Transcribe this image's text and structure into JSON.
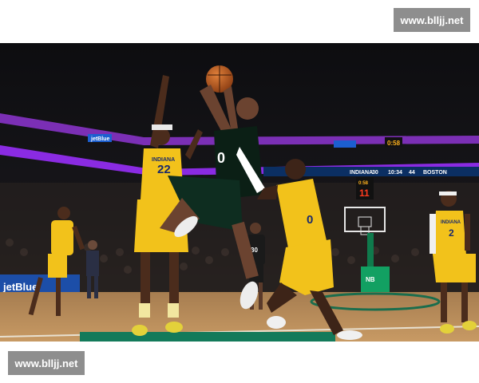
{
  "watermark": {
    "text": "www.blljj.net"
  },
  "scene": {
    "description_hidden": "",
    "ribbon_upper": {
      "brand": "jetBlue",
      "score_small": "0:58"
    },
    "ribbon_lower": {
      "team_home": "INDIANA",
      "score_home": "30",
      "clock": "10:34",
      "score_away": "44",
      "team_away": "BOSTON"
    },
    "shot_clock": "11",
    "shot_clock_top": "0:58",
    "courtside_ad": "jetBlue",
    "court_logo": "NB",
    "jerseys": {
      "left_defender": "22",
      "left_defender_team": "INDIANA",
      "shooter": "0",
      "right_defender": "0",
      "far_right": "2",
      "far_right_team": "INDIANA",
      "far_left": "",
      "background_boston": "30"
    },
    "colors": {
      "pacers_gold": "#f2c21b",
      "celtics_green": "#0a3d2a",
      "ribbon_purple": "#8a2be2",
      "court_wood": "#c9a06b"
    }
  }
}
